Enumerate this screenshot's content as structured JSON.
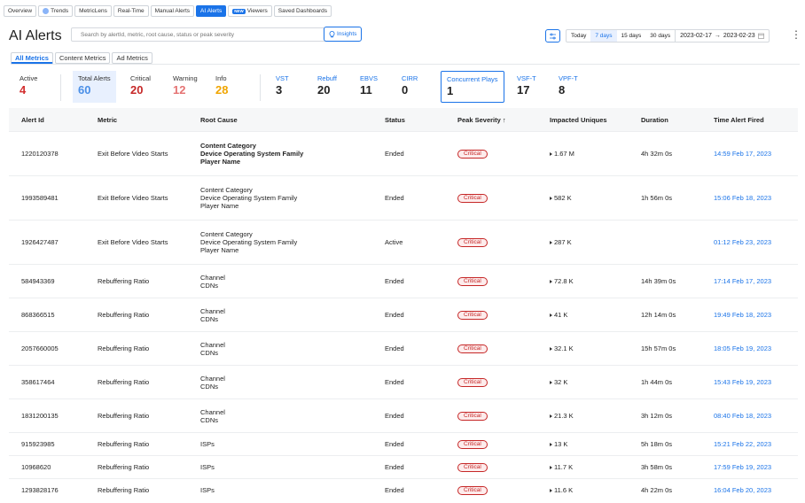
{
  "nav": {
    "tabs": [
      {
        "label": "Overview",
        "icon": "",
        "active": false
      },
      {
        "label": "Trends",
        "icon": "trend-icon",
        "active": false
      },
      {
        "label": "MetricLens",
        "icon": "",
        "active": false
      },
      {
        "label": "Real-Time",
        "icon": "",
        "active": false
      },
      {
        "label": "Manual Alerts",
        "icon": "",
        "active": false
      },
      {
        "label": "AI Alerts",
        "icon": "",
        "active": true
      },
      {
        "label": "Viewers",
        "icon": "viewers-badge",
        "badge": "NEW",
        "active": false
      },
      {
        "label": "Saved Dashboards",
        "icon": "",
        "active": false
      }
    ]
  },
  "header": {
    "title": "AI Alerts",
    "search_placeholder": "Search by alertId, metric, root cause, status or peak severity",
    "insights_label": "Insights",
    "range_buttons": [
      "Today",
      "7 days",
      "15 days",
      "30 days"
    ],
    "active_range": "7 days",
    "date_from": "2023-02-17",
    "date_arrow": "→",
    "date_to": "2023-02-23"
  },
  "subtabs": [
    "All Metrics",
    "Content Metrics",
    "Ad Metrics"
  ],
  "summary": {
    "active": {
      "label": "Active",
      "value": "4",
      "color": "#d32f2f"
    },
    "total": {
      "label": "Total Alerts",
      "value": "60",
      "color": "#1a73e8"
    },
    "critical": {
      "label": "Critical",
      "value": "20",
      "color": "#c62828"
    },
    "warning": {
      "label": "Warning",
      "value": "12",
      "color": "#e57373"
    },
    "info": {
      "label": "Info",
      "value": "28",
      "color": "#f0a500"
    },
    "metrics": [
      {
        "label": "VST",
        "value": "3"
      },
      {
        "label": "Rebuff",
        "value": "20"
      },
      {
        "label": "EBVS",
        "value": "11"
      },
      {
        "label": "CIRR",
        "value": "0"
      },
      {
        "label": "Concurrent Plays",
        "value": "1"
      },
      {
        "label": "VSF-T",
        "value": "17"
      },
      {
        "label": "VPF-T",
        "value": "8"
      }
    ]
  },
  "table": {
    "headers": [
      "Alert Id",
      "Metric",
      "Root Cause",
      "Status",
      "Peak Severity ↑",
      "Impacted Uniques",
      "Duration",
      "Time Alert Fired"
    ],
    "rows": [
      {
        "id": "1220120378",
        "metric": "Exit Before Video Starts",
        "root_cause": [
          "Content Category",
          "Device Operating System Family",
          "Player Name"
        ],
        "bold": true,
        "status": "Ended",
        "severity": "Critical",
        "uniques": "1.67 M",
        "duration": "4h 32m 0s",
        "time": "14:59 Feb 17, 2023"
      },
      {
        "id": "1993589481",
        "metric": "Exit Before Video Starts",
        "root_cause": [
          "Content Category",
          "Device Operating System Family",
          "Player Name"
        ],
        "bold": false,
        "status": "Ended",
        "severity": "Critical",
        "uniques": "582 K",
        "duration": "1h 56m 0s",
        "time": "15:06 Feb 18, 2023"
      },
      {
        "id": "1926427487",
        "metric": "Exit Before Video Starts",
        "root_cause": [
          "Content Category",
          "Device Operating System Family",
          "Player Name"
        ],
        "bold": false,
        "status": "Active",
        "severity": "Critical",
        "uniques": "287 K",
        "duration": "",
        "time": "01:12 Feb 23, 2023"
      },
      {
        "id": "584943369",
        "metric": "Rebuffering Ratio",
        "root_cause": [
          "Channel",
          "CDNs"
        ],
        "bold": false,
        "status": "Ended",
        "severity": "Critical",
        "uniques": "72.8 K",
        "duration": "14h 39m 0s",
        "time": "17:14 Feb 17, 2023"
      },
      {
        "id": "868366515",
        "metric": "Rebuffering Ratio",
        "root_cause": [
          "Channel",
          "CDNs"
        ],
        "bold": false,
        "status": "Ended",
        "severity": "Critical",
        "uniques": "41 K",
        "duration": "12h 14m 0s",
        "time": "19:49 Feb 18, 2023"
      },
      {
        "id": "2057660005",
        "metric": "Rebuffering Ratio",
        "root_cause": [
          "Channel",
          "CDNs"
        ],
        "bold": false,
        "status": "Ended",
        "severity": "Critical",
        "uniques": "32.1 K",
        "duration": "15h 57m 0s",
        "time": "18:05 Feb 19, 2023"
      },
      {
        "id": "358617464",
        "metric": "Rebuffering Ratio",
        "root_cause": [
          "Channel",
          "CDNs"
        ],
        "bold": false,
        "status": "Ended",
        "severity": "Critical",
        "uniques": "32 K",
        "duration": "1h 44m 0s",
        "time": "15:43 Feb 19, 2023"
      },
      {
        "id": "1831200135",
        "metric": "Rebuffering Ratio",
        "root_cause": [
          "Channel",
          "CDNs"
        ],
        "bold": false,
        "status": "Ended",
        "severity": "Critical",
        "uniques": "21.3 K",
        "duration": "3h 12m 0s",
        "time": "08:40 Feb 18, 2023"
      },
      {
        "id": "915923985",
        "metric": "Rebuffering Ratio",
        "root_cause": [
          "ISPs"
        ],
        "bold": false,
        "status": "Ended",
        "severity": "Critical",
        "uniques": "13 K",
        "duration": "5h 18m 0s",
        "time": "15:21 Feb 22, 2023"
      },
      {
        "id": "10968620",
        "metric": "Rebuffering Ratio",
        "root_cause": [
          "ISPs"
        ],
        "bold": false,
        "status": "Ended",
        "severity": "Critical",
        "uniques": "11.7 K",
        "duration": "3h 58m 0s",
        "time": "17:59 Feb 19, 2023"
      },
      {
        "id": "1293828176",
        "metric": "Rebuffering Ratio",
        "root_cause": [
          "ISPs"
        ],
        "bold": false,
        "status": "Ended",
        "severity": "Critical",
        "uniques": "11.6 K",
        "duration": "4h 22m 0s",
        "time": "16:04 Feb 20, 2023"
      }
    ]
  }
}
